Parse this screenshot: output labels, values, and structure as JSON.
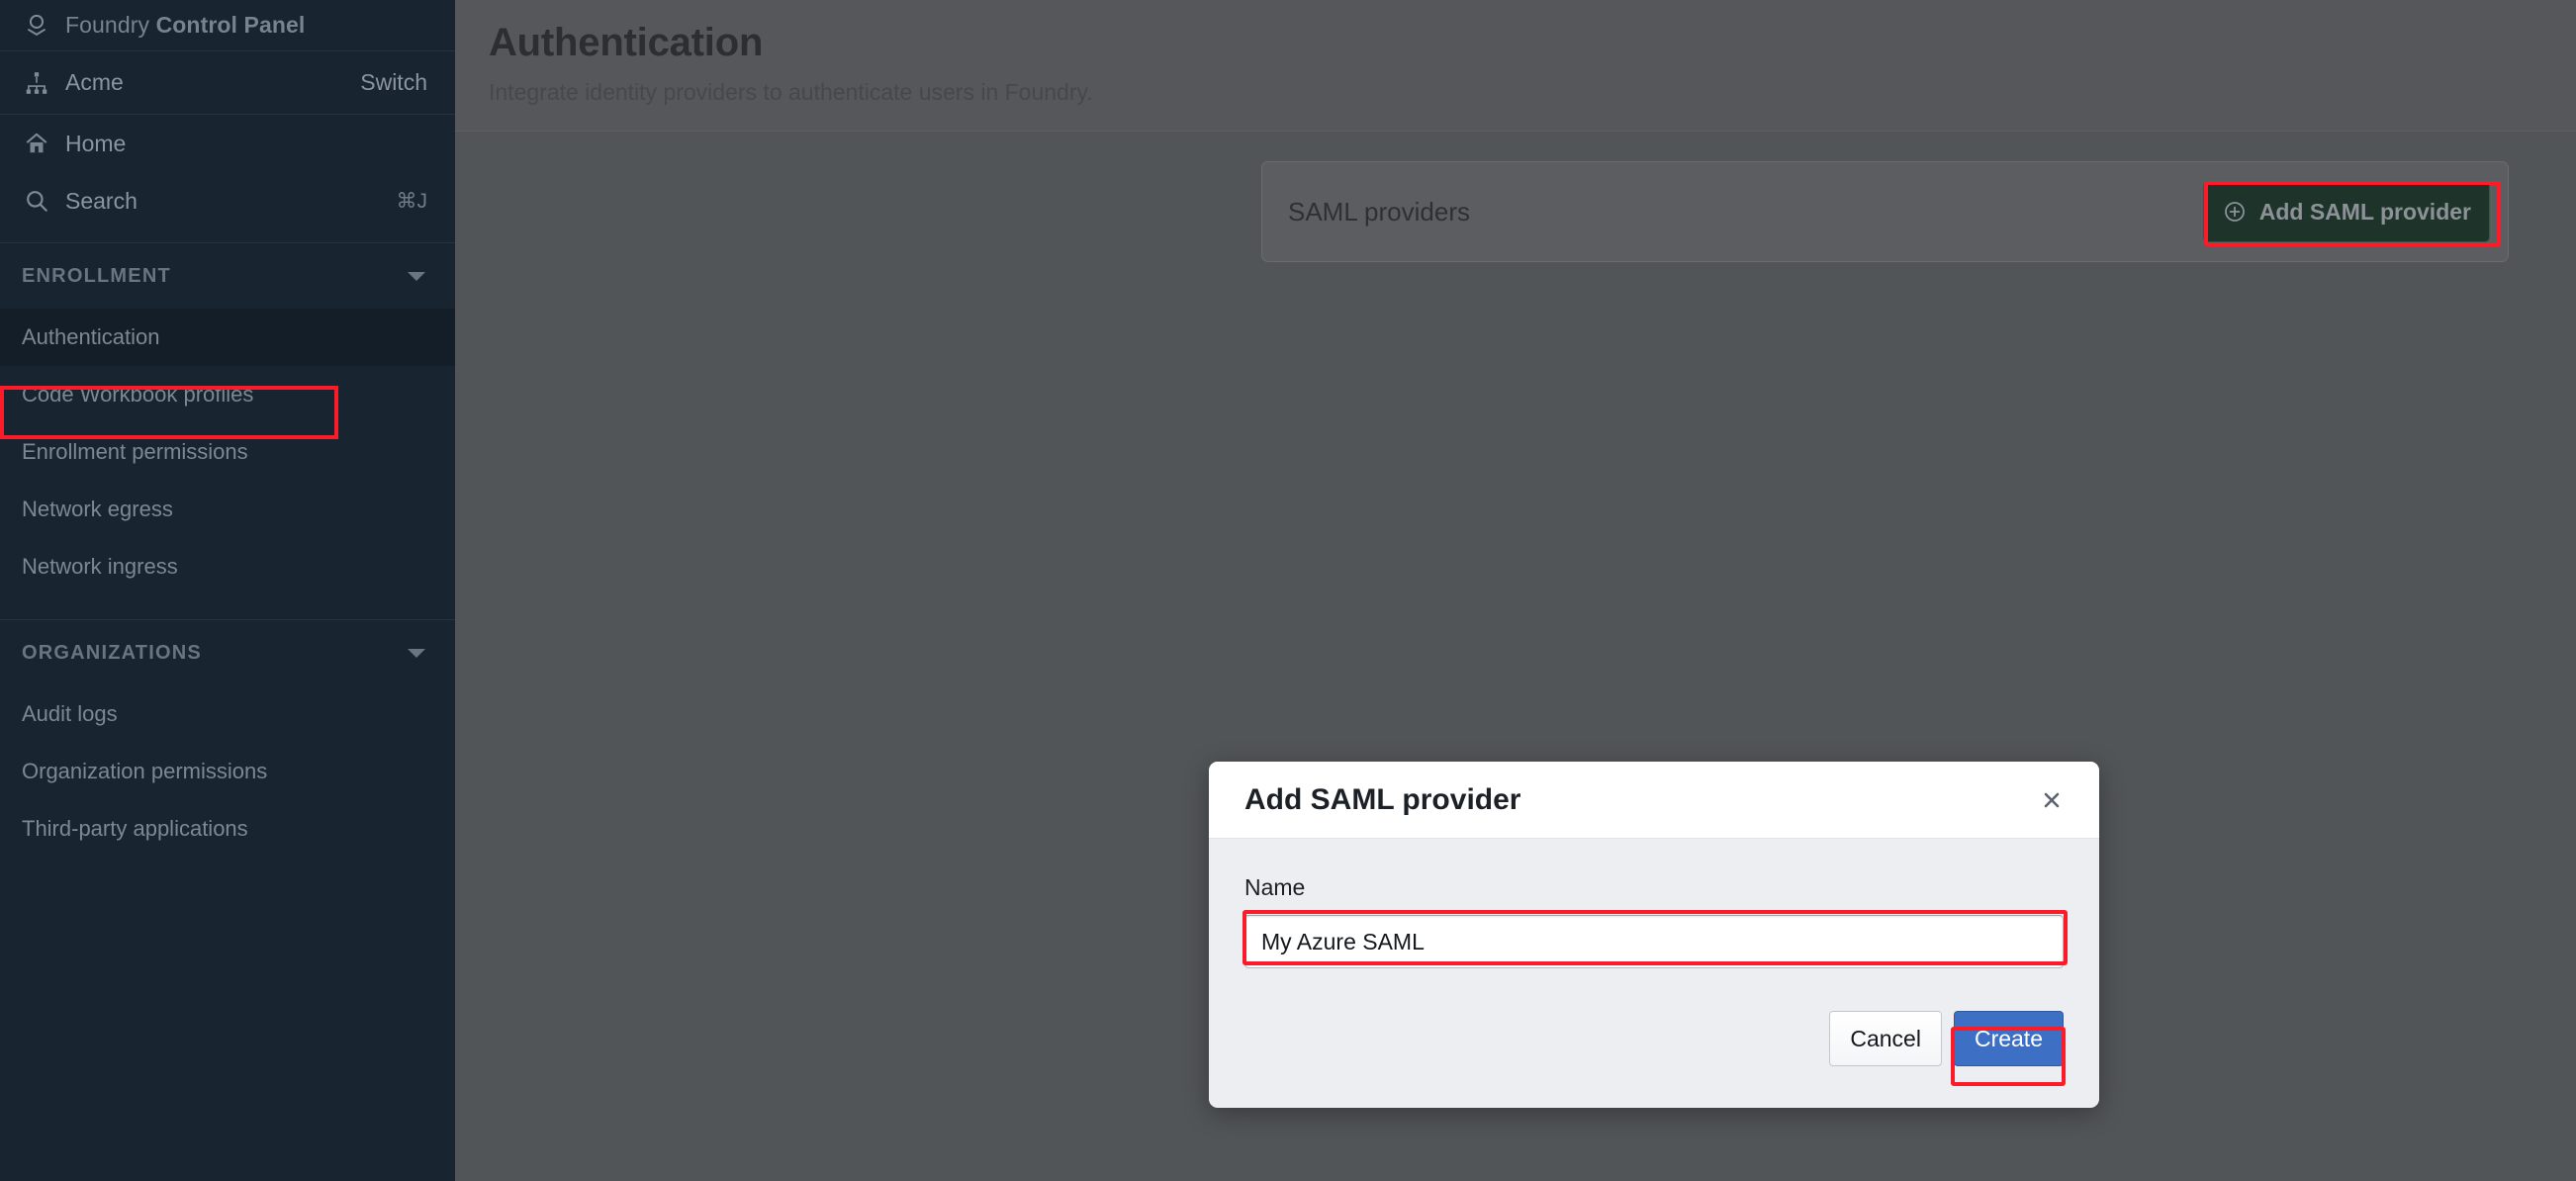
{
  "sidebar": {
    "brand": {
      "prefix": "Foundry ",
      "bold": "Control Panel",
      "icon": "foundry-logo-icon"
    },
    "org": {
      "name": "Acme",
      "switch_label": "Switch",
      "icon": "org-hierarchy-icon"
    },
    "links": [
      {
        "label": "Home",
        "icon": "home-icon",
        "kbd": ""
      },
      {
        "label": "Search",
        "icon": "search-icon",
        "kbd": "⌘J"
      }
    ],
    "sections": [
      {
        "label": "ENROLLMENT",
        "items": [
          {
            "label": "Authentication",
            "active": true
          },
          {
            "label": "Code Workbook profiles",
            "active": false
          },
          {
            "label": "Enrollment permissions",
            "active": false
          },
          {
            "label": "Network egress",
            "active": false
          },
          {
            "label": "Network ingress",
            "active": false
          }
        ]
      },
      {
        "label": "ORGANIZATIONS",
        "items": [
          {
            "label": "Audit logs",
            "active": false
          },
          {
            "label": "Organization permissions",
            "active": false
          },
          {
            "label": "Third-party applications",
            "active": false
          }
        ]
      }
    ]
  },
  "page": {
    "title": "Authentication",
    "subtitle": "Integrate identity providers to authenticate users in Foundry."
  },
  "card": {
    "title": "SAML providers",
    "add_button_label": "Add SAML provider",
    "add_button_icon": "plus-circle-icon"
  },
  "modal": {
    "title": "Add SAML provider",
    "close_icon": "close-icon",
    "field_label": "Name",
    "field_value": "My Azure SAML",
    "field_placeholder": "",
    "cancel_label": "Cancel",
    "create_label": "Create"
  },
  "colors": {
    "sidebar_bg": "#18242f",
    "sidebar_active": "#141e28",
    "content_bg": "#525558",
    "header_bg": "#55575a",
    "card_bg": "#5b5d60",
    "green_button_bg": "#1e3329",
    "primary_button_bg": "#3d6fc4",
    "annotation_red": "#fc1b28",
    "modal_body_bg": "#edeef1"
  }
}
